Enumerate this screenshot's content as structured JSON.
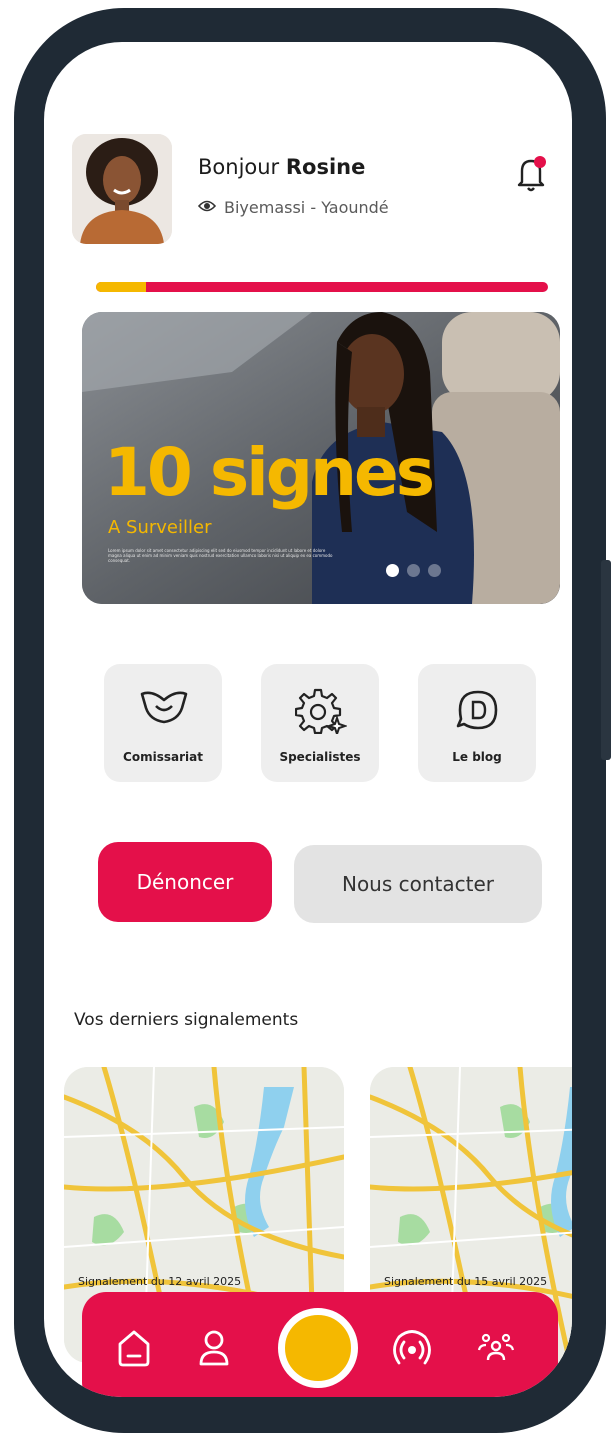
{
  "header": {
    "greeting": "Bonjour",
    "user_name": "Rosine",
    "location": "Biyemassi - Yaoundé",
    "has_notification": true
  },
  "progress": {
    "value": 0.11
  },
  "banner": {
    "title": "10 signes",
    "subtitle": "A Surveiller",
    "body": "Lorem ipsum dolor sit amet consectetur adipiscing elit sed do eiusmod tempor incididunt ut labore et dolore magna aliqua ut enim ad minim veniam quis nostrud exercitation ullamco laboris nisi ut aliquip ex ea commodo consequat.",
    "slides": 3,
    "active_slide": 1
  },
  "quick_actions": [
    {
      "label": "Comissariat",
      "icon": "police-badge-icon"
    },
    {
      "label": "Specialistes",
      "icon": "gear-sparkle-icon"
    },
    {
      "label": "Le blog",
      "icon": "chat-bubble-icon"
    }
  ],
  "actions": {
    "primary": "Dénoncer",
    "secondary": "Nous contacter"
  },
  "reports": {
    "title": "Vos derniers signalements",
    "items": [
      {
        "caption": "Signalement du 12 avril 2025"
      },
      {
        "caption": "Signalement du 15 avril 2025"
      }
    ]
  },
  "nav": [
    {
      "name": "home-icon"
    },
    {
      "name": "profile-icon"
    },
    {
      "name": "alert-center-button"
    },
    {
      "name": "broadcast-icon"
    },
    {
      "name": "community-icon"
    }
  ],
  "colors": {
    "primary": "#e4104a",
    "accent": "#f5b800",
    "frame": "#1f2a35"
  }
}
